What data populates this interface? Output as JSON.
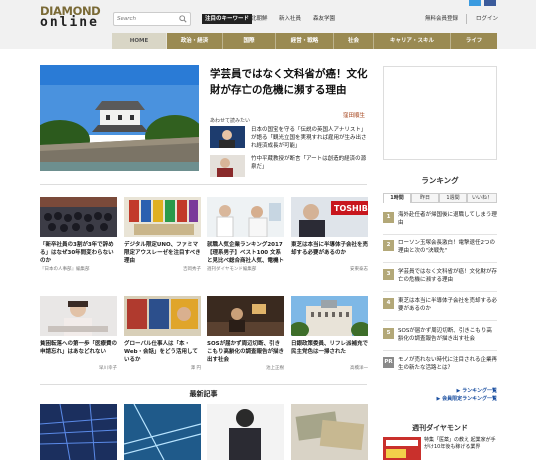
{
  "header": {
    "logo_line1": "DIAMOND",
    "logo_line2": "online",
    "search_placeholder": "Search",
    "keyword_label": "注目のキーワード",
    "keywords": [
      "北朝鮮",
      "新入社員",
      "森友学園"
    ],
    "register_link": "無料会員登録",
    "login_link": "ログイン"
  },
  "nav": {
    "items": [
      "HOME",
      "政治・経済",
      "国際",
      "経営・戦略",
      "社会",
      "キャリア・スキル",
      "ライフ"
    ]
  },
  "hero": {
    "title": "学芸員ではなく文科省が癌！文化財が存亡の危機に瀕する理由",
    "author": "窪田順生",
    "see_also": "あわせて読みたい",
    "related": [
      {
        "text": "日本の国宝を守る「伝説の英国人アナリスト」が語る「観光立国を実現すれば雇用が生み出され経済成長が可能」"
      },
      {
        "text": "竹中平蔵教授が断言「アートは創造的経済の源泉だ」"
      }
    ]
  },
  "cards_row1": [
    {
      "title": "「新卒社員の3割が3年で辞める」はなぜ30年間変わらないのか",
      "meta_left": "『日本の人事部』編集部",
      "meta_right": ""
    },
    {
      "title": "デジタル限定UNO、ファミマ限定アウスレーゼを注目すべき理由",
      "meta_left": "",
      "meta_right": "吉岡秀子"
    },
    {
      "title": "就職人気企業ランキング2017【理系男子】ベスト100 文系と見比べ総合商社人気、電機トップ10から脱落",
      "meta_left": "週刊ダイヤモンド編集部",
      "meta_right": ""
    },
    {
      "title": "東芝は本当に半導体子会社を売却する必要があるのか",
      "meta_left": "",
      "meta_right": "安東泰志"
    }
  ],
  "cards_row2": [
    {
      "title": "貧困転落への第一歩「医療費の申請忘れ」はあなどれない",
      "meta_left": "",
      "meta_right": "早川幸子"
    },
    {
      "title": "グローバル仕事人は「本・Web・会話」をどう活用しているか",
      "meta_left": "",
      "meta_right": "澤 円"
    },
    {
      "title": "SOSが届かず周辺切断、引きこもり高齢化の調査報告が描き出す社会",
      "meta_left": "",
      "meta_right": "池上正樹"
    },
    {
      "title": "日銀政策委員、リフレ派補充で民主党色は一掃された",
      "meta_left": "",
      "meta_right": "高橋洋一"
    }
  ],
  "latest_title": "最新記事",
  "ranking": {
    "title": "ランキング",
    "tabs": [
      "1時間",
      "昨日",
      "1週間",
      "いいね！"
    ],
    "items": [
      {
        "num": "1",
        "text": "海外赴任者が帰国後に退職してしまう理由"
      },
      {
        "num": "2",
        "text": "ローソン玉塚会長激白！電撃退任2つの理由と次の\"決戦先\""
      },
      {
        "num": "3",
        "text": "学芸員ではなく文科省が癌！文化財が存亡の危機に瀕する理由"
      },
      {
        "num": "4",
        "text": "東芝は本当に半導体子会社を売却する必要があるのか"
      },
      {
        "num": "5",
        "text": "SOSが届かず周辺切断、引きこもり高齢化の調査報告が描き出す社会"
      },
      {
        "num": "PR",
        "text": "モノが売れない時代に注目される企業再生の新たな活路とは？"
      }
    ],
    "link1": "ランキング一覧",
    "link2": "会員限定ランキング一覧"
  },
  "weekly": {
    "title": "週刊ダイヤモンド",
    "text": "特集「医薬」の教え 起業家が手がけ10年後も稼げる業界"
  }
}
